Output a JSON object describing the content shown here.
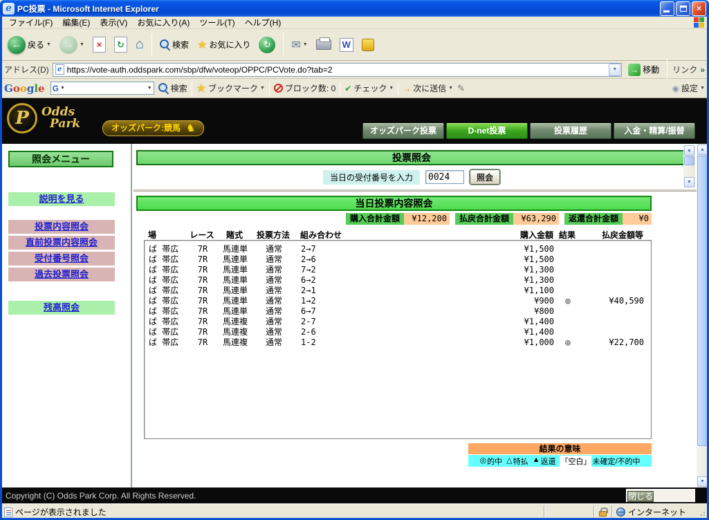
{
  "window": {
    "title": "PC投票 - Microsoft Internet Explorer"
  },
  "menu": {
    "items": [
      "ファイル(F)",
      "編集(E)",
      "表示(V)",
      "お気に入り(A)",
      "ツール(T)",
      "ヘルプ(H)"
    ]
  },
  "toolbar": {
    "back": "戻る",
    "search": "検索",
    "favorites": "お気に入り"
  },
  "address": {
    "label": "アドレス(D)",
    "url": "https://vote-auth.oddspark.com/sbp/dfw/voteop/OPPC/PCVote.do?tab=2",
    "go": "移動",
    "links": "リンク"
  },
  "google": {
    "logo_letters": [
      "G",
      "o",
      "o",
      "g",
      "l",
      "e"
    ],
    "search": "検索",
    "bookmarks": "ブックマーク",
    "blocked": "ブロック数: 0",
    "check": "チェック",
    "send": "次に送信",
    "settings": "設定"
  },
  "header": {
    "logo_mark": "P",
    "logo_line1": "Odds",
    "logo_line2": "Park",
    "banner": "オッズパーク:競馬",
    "nav": [
      {
        "label": "オッズパーク投票",
        "state": "normal"
      },
      {
        "label": "D-net投票",
        "state": "active"
      },
      {
        "label": "投票履歴",
        "state": "normal"
      },
      {
        "label": "入金・精算/振替",
        "state": "normal"
      }
    ]
  },
  "sidebar": {
    "title": "照会メニュー",
    "items": [
      {
        "label": "説明を見る",
        "style": "green"
      },
      {
        "label": "投票内容照会",
        "style": "pink"
      },
      {
        "label": "直前投票内容照会",
        "style": "pink"
      },
      {
        "label": "受付番号照会",
        "style": "pink"
      },
      {
        "label": "過去投票照会",
        "style": "pink"
      },
      {
        "label": "残高照会",
        "style": "green"
      }
    ]
  },
  "inquiry": {
    "title": "投票照会",
    "input_label": "当日の受付番号を入力",
    "receipt_no": "0024",
    "submit": "照会"
  },
  "today": {
    "title": "当日投票内容照会",
    "totals": [
      {
        "label": "購入合計金額",
        "value": "¥12,200"
      },
      {
        "label": "払戻合計金額",
        "value": "¥63,290"
      },
      {
        "label": "返還合計金額",
        "value": "¥0"
      }
    ],
    "columns": [
      "場",
      "レース",
      "賭式",
      "投票方法",
      "組み合わせ",
      "購入金額",
      "結果",
      "払戻金額等"
    ],
    "rows": [
      {
        "place": "ば 帯広",
        "race": "7R",
        "type": "馬連単",
        "method": "通常",
        "combo": "2→7",
        "amount": "¥1,500",
        "result": "",
        "payout": ""
      },
      {
        "place": "ば 帯広",
        "race": "7R",
        "type": "馬連単",
        "method": "通常",
        "combo": "2→6",
        "amount": "¥1,500",
        "result": "",
        "payout": ""
      },
      {
        "place": "ば 帯広",
        "race": "7R",
        "type": "馬連単",
        "method": "通常",
        "combo": "7→2",
        "amount": "¥1,300",
        "result": "",
        "payout": ""
      },
      {
        "place": "ば 帯広",
        "race": "7R",
        "type": "馬連単",
        "method": "通常",
        "combo": "6→2",
        "amount": "¥1,300",
        "result": "",
        "payout": ""
      },
      {
        "place": "ば 帯広",
        "race": "7R",
        "type": "馬連単",
        "method": "通常",
        "combo": "2→1",
        "amount": "¥1,100",
        "result": "",
        "payout": ""
      },
      {
        "place": "ば 帯広",
        "race": "7R",
        "type": "馬連単",
        "method": "通常",
        "combo": "1→2",
        "amount": "¥900",
        "result": "◎",
        "payout": "¥40,590"
      },
      {
        "place": "ば 帯広",
        "race": "7R",
        "type": "馬連単",
        "method": "通常",
        "combo": "6→7",
        "amount": "¥800",
        "result": "",
        "payout": ""
      },
      {
        "place": "ば 帯広",
        "race": "7R",
        "type": "馬連複",
        "method": "通常",
        "combo": "2-7",
        "amount": "¥1,400",
        "result": "",
        "payout": ""
      },
      {
        "place": "ば 帯広",
        "race": "7R",
        "type": "馬連複",
        "method": "通常",
        "combo": "2-6",
        "amount": "¥1,400",
        "result": "",
        "payout": ""
      },
      {
        "place": "ば 帯広",
        "race": "7R",
        "type": "馬連複",
        "method": "通常",
        "combo": "1-2",
        "amount": "¥1,000",
        "result": "◎",
        "payout": "¥22,700"
      }
    ],
    "legend_title": "結果の意味",
    "legend": [
      {
        "symbol": "◎",
        "label": "的中"
      },
      {
        "symbol": "△",
        "label": "特払"
      },
      {
        "symbol": "▲",
        "label": "返還"
      },
      {
        "symbol": "「空白」",
        "label": "未確定/不的中"
      }
    ]
  },
  "footer": {
    "copyright": "Copyright (C) Odds Park Corp. All Rights Reserved.",
    "close": "閉じる"
  },
  "status": {
    "message": "ページが表示されました",
    "zone": "インターネット"
  },
  "icons": {
    "back_arrow": "←",
    "forward_arrow": "→",
    "stop_x": "×",
    "refresh_arrows": "↻",
    "home": "⌂",
    "history": "↻",
    "mail": "✉",
    "dropdown": "▼",
    "chevron": "»",
    "go_arrow": "→",
    "star": "★",
    "check": "✔",
    "send_arrow": "→",
    "pen": "✎",
    "settings_dot": "◉",
    "horse": "♞",
    "up_arrow": "▲",
    "down_arrow": "▼",
    "close_x": "×",
    "w_logo": "W",
    "g_logo": "G"
  }
}
